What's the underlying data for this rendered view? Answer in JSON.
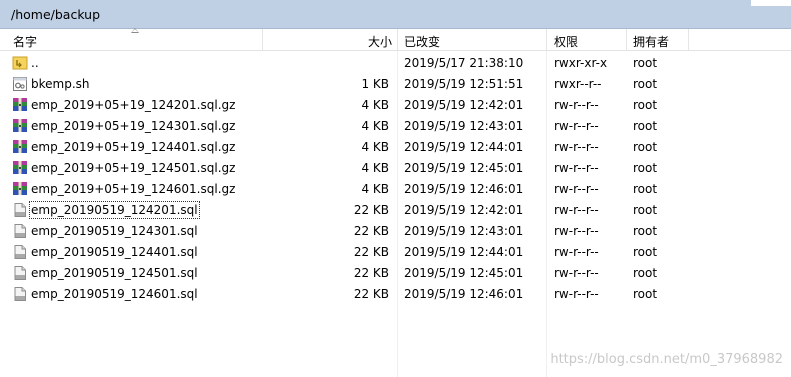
{
  "path": "/home/backup",
  "columns": {
    "name": "名字",
    "size": "大小",
    "modified": "已改变",
    "permissions": "权限",
    "owner": "拥有者"
  },
  "files": [
    {
      "icon": "parent-folder-icon",
      "name": "..",
      "size": "",
      "modified": "2019/5/17 21:38:10",
      "permissions": "rwxr-xr-x",
      "owner": "root"
    },
    {
      "icon": "script-file-icon",
      "name": "bkemp.sh",
      "size": "1 KB",
      "modified": "2019/5/19 12:51:51",
      "permissions": "rwxr--r--",
      "owner": "root"
    },
    {
      "icon": "archive-icon",
      "name": "emp_2019+05+19_124201.sql.gz",
      "size": "4 KB",
      "modified": "2019/5/19 12:42:01",
      "permissions": "rw-r--r--",
      "owner": "root"
    },
    {
      "icon": "archive-icon",
      "name": "emp_2019+05+19_124301.sql.gz",
      "size": "4 KB",
      "modified": "2019/5/19 12:43:01",
      "permissions": "rw-r--r--",
      "owner": "root"
    },
    {
      "icon": "archive-icon",
      "name": "emp_2019+05+19_124401.sql.gz",
      "size": "4 KB",
      "modified": "2019/5/19 12:44:01",
      "permissions": "rw-r--r--",
      "owner": "root"
    },
    {
      "icon": "archive-icon",
      "name": "emp_2019+05+19_124501.sql.gz",
      "size": "4 KB",
      "modified": "2019/5/19 12:45:01",
      "permissions": "rw-r--r--",
      "owner": "root"
    },
    {
      "icon": "archive-icon",
      "name": "emp_2019+05+19_124601.sql.gz",
      "size": "4 KB",
      "modified": "2019/5/19 12:46:01",
      "permissions": "rw-r--r--",
      "owner": "root"
    },
    {
      "icon": "sql-file-icon",
      "name": "emp_20190519_124201.sql",
      "size": "22 KB",
      "modified": "2019/5/19 12:42:01",
      "permissions": "rw-r--r--",
      "owner": "root"
    },
    {
      "icon": "sql-file-icon",
      "name": "emp_20190519_124301.sql",
      "size": "22 KB",
      "modified": "2019/5/19 12:43:01",
      "permissions": "rw-r--r--",
      "owner": "root"
    },
    {
      "icon": "sql-file-icon",
      "name": "emp_20190519_124401.sql",
      "size": "22 KB",
      "modified": "2019/5/19 12:44:01",
      "permissions": "rw-r--r--",
      "owner": "root"
    },
    {
      "icon": "sql-file-icon",
      "name": "emp_20190519_124501.sql",
      "size": "22 KB",
      "modified": "2019/5/19 12:45:01",
      "permissions": "rw-r--r--",
      "owner": "root"
    },
    {
      "icon": "sql-file-icon",
      "name": "emp_20190519_124601.sql",
      "size": "22 KB",
      "modified": "2019/5/19 12:46:01",
      "permissions": "rw-r--r--",
      "owner": "root"
    }
  ],
  "watermark": "https://blog.csdn.net/m0_37968982"
}
